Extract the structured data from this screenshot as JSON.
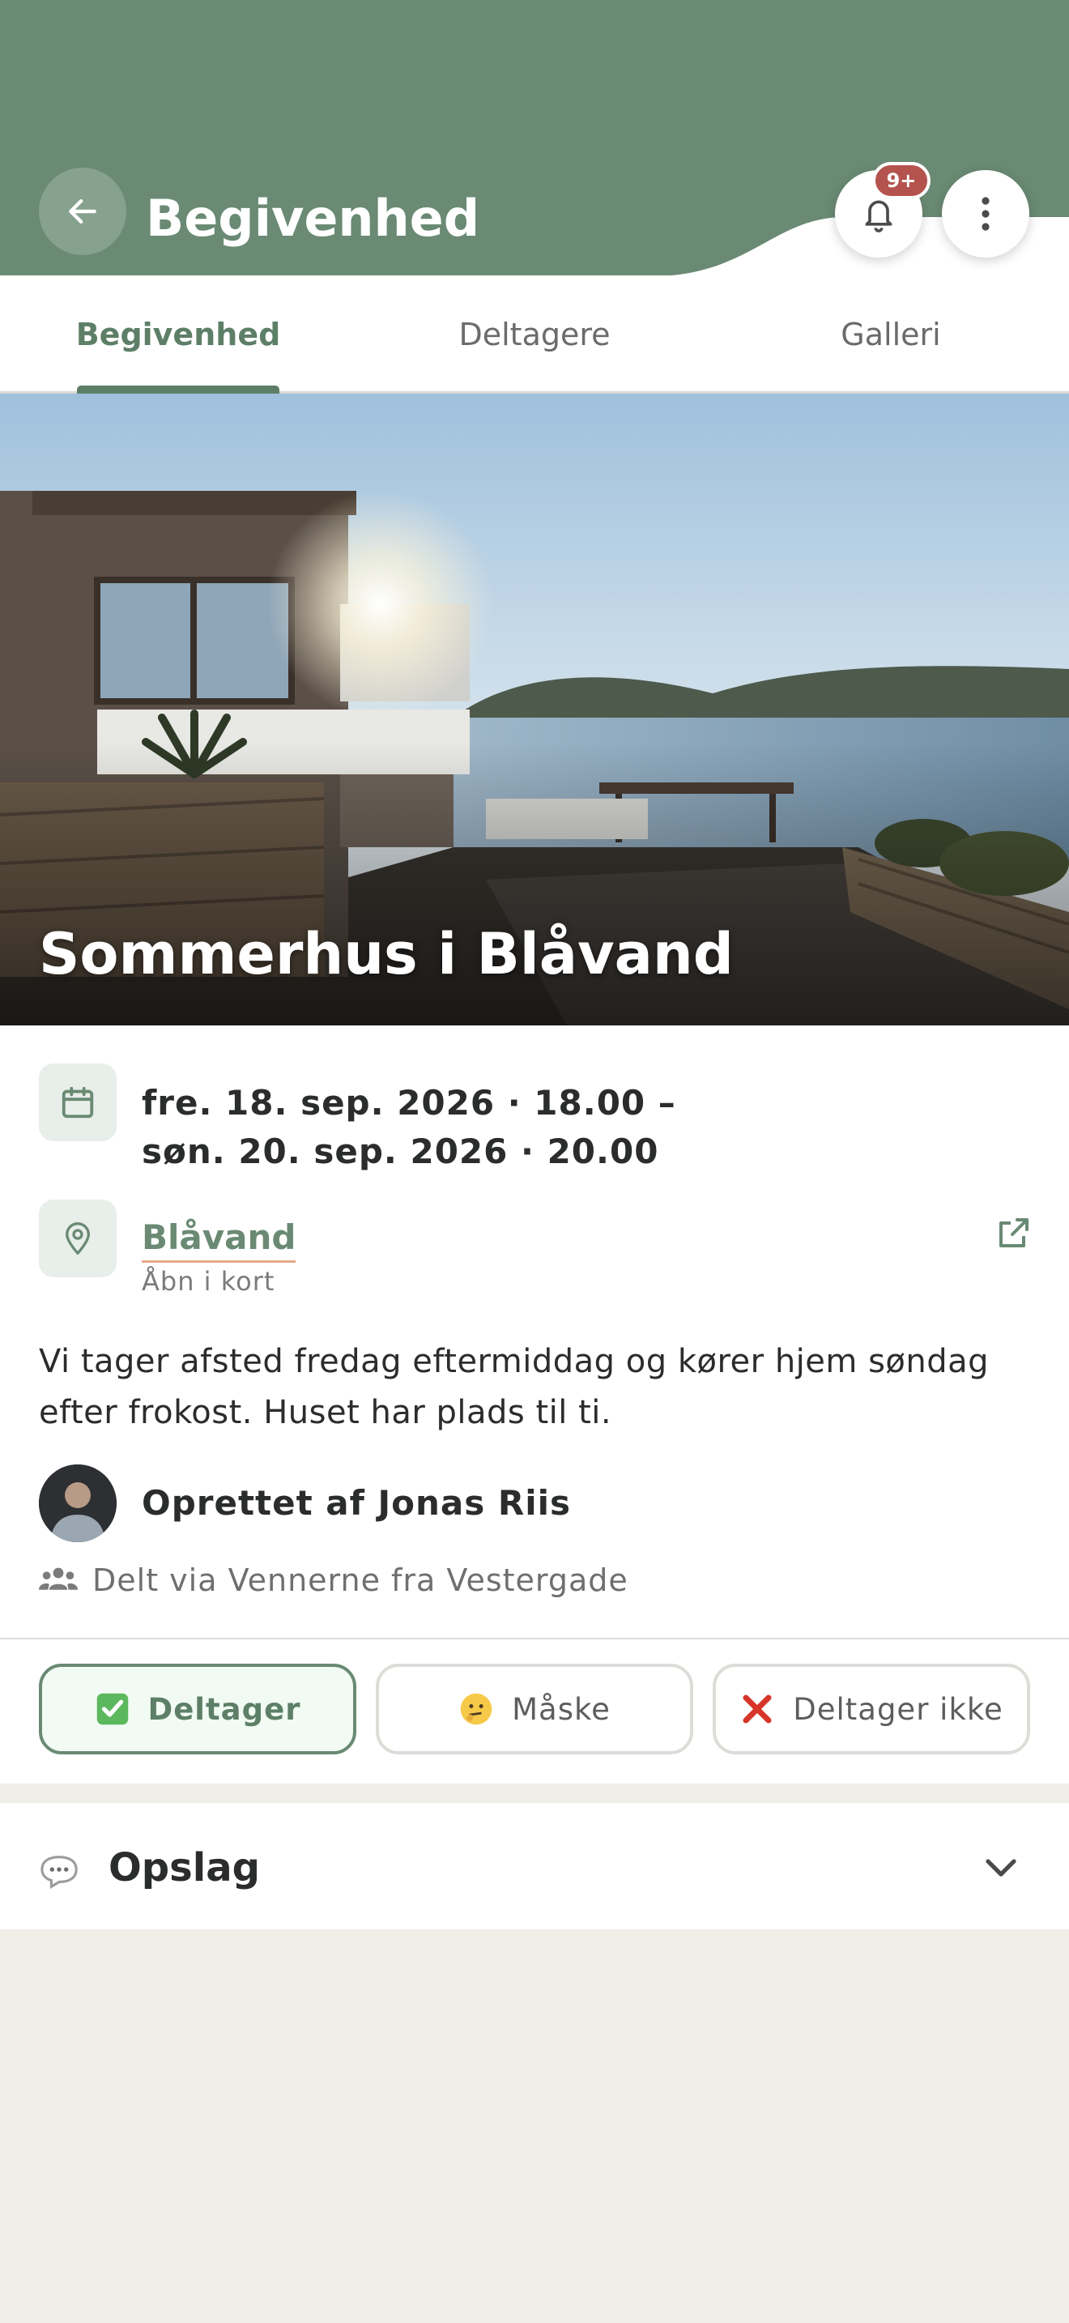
{
  "header": {
    "title": "Begivenhed",
    "notification_badge": "9+"
  },
  "tabs": [
    {
      "label": "Begivenhed",
      "active": true
    },
    {
      "label": "Deltagere",
      "active": false
    },
    {
      "label": "Galleri",
      "active": false
    }
  ],
  "event": {
    "title": "Sommerhus i Blåvand",
    "date_start": "fre. 18. sep. 2026 · 18.00 –",
    "date_end": "søn. 20. sep. 2026 · 20.00",
    "location": "Blåvand",
    "location_action": "Åbn i kort",
    "description": "Vi tager afsted fredag eftermiddag og kører hjem søndag efter frokost. Huset har plads til ti.",
    "created_by": "Oprettet af Jonas Riis",
    "shared_via": "Delt via Vennerne fra Vestergade"
  },
  "rsvp": {
    "going": "Deltager",
    "maybe": "Måske",
    "not_going": "Deltager ikke",
    "selected": "going"
  },
  "posts": {
    "title": "Opslag"
  },
  "colors": {
    "header_green": "#6a8a73",
    "accent_green": "#5d7f67",
    "badge_red": "#b4534e",
    "background": "#f1eee8"
  },
  "icons": {
    "back": "arrow-left-icon",
    "notifications": "bell-icon",
    "more": "more-vertical-icon",
    "date": "calendar-icon",
    "location": "map-pin-icon",
    "external": "external-link-icon",
    "shared": "group-icon",
    "posts": "speech-bubble-icon",
    "expand": "chevron-down-icon"
  }
}
